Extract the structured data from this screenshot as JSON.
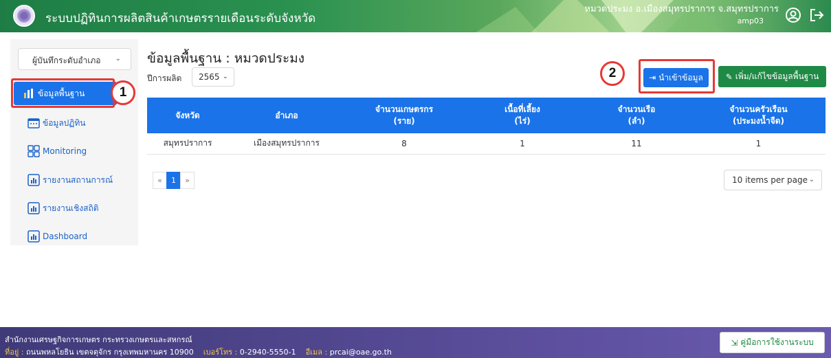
{
  "header": {
    "app_title": "ระบบปฏิทินการผลิตสินค้าเกษตรรายเดือนระดับจังหวัด",
    "unit_text": "หมวดประมง อ.เมืองสมุทรปราการ จ.สมุทรปราการ",
    "username": "amp03",
    "colors": {
      "primary": "#1e7d45"
    }
  },
  "sidebar": {
    "role": "ผู้บันทึกระดับอำเภอ",
    "items": [
      {
        "label": "ข้อมูลพื้นฐาน",
        "icon": "bar-chart-icon",
        "active": true
      },
      {
        "label": "ข้อมูลปฏิทิน",
        "icon": "calendar-icon"
      },
      {
        "label": "Monitoring",
        "icon": "grid-icon"
      },
      {
        "label": "รายงานสถานการณ์",
        "icon": "report-icon"
      },
      {
        "label": "รายงานเชิงสถิติ",
        "icon": "report-icon"
      },
      {
        "label": "Dashboard",
        "icon": "report-icon"
      }
    ]
  },
  "annotations": {
    "one": "1",
    "two": "2"
  },
  "main": {
    "title": "ข้อมูลพื้นฐาน : หมวดประมง",
    "year_label": "ปีการผลิต",
    "year_value": "2565",
    "import_button": "นำเข้าข้อมูล",
    "edit_button": "เพิ่ม/แก้ไขข้อมูลพื้นฐาน",
    "table": {
      "headers": [
        [
          "จังหวัด"
        ],
        [
          "อำเภอ"
        ],
        [
          "จำนวนเกษตรกร",
          "(ราย)"
        ],
        [
          "เนื้อที่เลี้ยง",
          "(ไร่)"
        ],
        [
          "จำนวนเรือ",
          "(ลำ)"
        ],
        [
          "จำนวนครัวเรือน",
          "(ประมงน้ำจืด)"
        ]
      ],
      "rows": [
        [
          "สมุทรปราการ",
          "เมืองสมุทรปราการ",
          "8",
          "1",
          "11",
          "1"
        ]
      ]
    },
    "pager": {
      "prev": "«",
      "current": "1",
      "next": "»"
    },
    "per_page": "10 items per page",
    "accent_color": "#1a73e8"
  },
  "footer": {
    "org": "สำนักงานเศรษฐกิจการเกษตร กระทรวงเกษตรและสหกรณ์",
    "address_label": "ที่อยู่ :",
    "address": "ถนนพหลโยธิน เขตจตุจักร กรุงเทพมหานคร 10900",
    "phone_label": "เบอร์โทร :",
    "phone": "0-2940-5550-1",
    "email_label": "อีเมล :",
    "email": "prcai@oae.go.th",
    "manual_button": "คู่มือการใช้งานระบบ"
  }
}
